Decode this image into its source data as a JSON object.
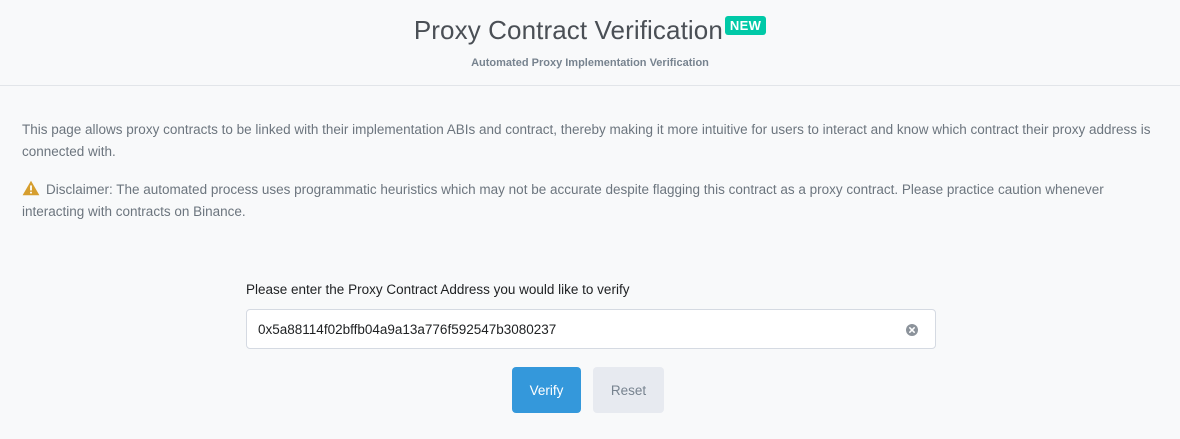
{
  "header": {
    "title": "Proxy Contract Verification",
    "badge": "NEW",
    "subtitle": "Automated Proxy Implementation Verification"
  },
  "intro": "This page allows proxy contracts to be linked with their implementation ABIs and contract, thereby making it more intuitive for users to interact and know which contract their proxy address is connected with.",
  "disclaimer": {
    "icon": "warning-icon",
    "text": "Disclaimer: The automated process uses programmatic heuristics which may not be accurate despite flagging this contract as a proxy contract. Please practice caution whenever interacting with contracts on Binance."
  },
  "form": {
    "label": "Please enter the Proxy Contract Address you would like to verify",
    "address_value": "0x5a88114f02bffb04a9a13a776f592547b3080237",
    "clear_icon": "clear-icon",
    "verify_label": "Verify",
    "reset_label": "Reset"
  },
  "colors": {
    "badge": "#00c9a7",
    "primary": "#3498db",
    "secondary": "#e7eaf0",
    "warning": "#d69e2e"
  }
}
